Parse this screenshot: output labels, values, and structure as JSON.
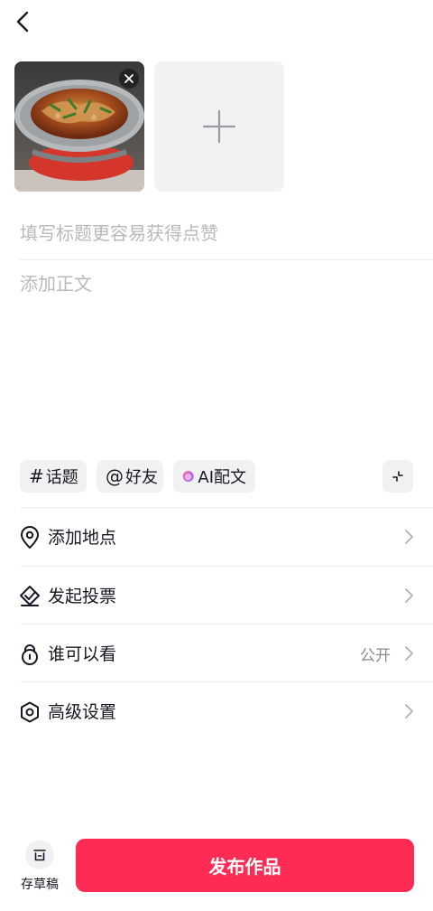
{
  "header": {
    "back_icon": "chevron-left-icon"
  },
  "media": {
    "photo_alt": "",
    "remove_icon": "close-icon",
    "add_icon": "plus-icon"
  },
  "post": {
    "title_placeholder": "填写标题更容易获得点赞",
    "body_placeholder": "添加正文"
  },
  "chips": {
    "topic_symbol": "#",
    "topic_label": "话题",
    "friend_symbol": "@",
    "friend_label": "好友",
    "ai_label": "AI配文",
    "collapse_icon": "collapse-icon"
  },
  "options": [
    {
      "label": "添加地点",
      "value": "",
      "icon": "location-pin-icon"
    },
    {
      "label": "发起投票",
      "value": "",
      "icon": "vote-icon"
    },
    {
      "label": "谁可以看",
      "value": "公开",
      "icon": "lock-icon"
    },
    {
      "label": "高级设置",
      "value": "",
      "icon": "settings-icon"
    }
  ],
  "footer": {
    "draft_label": "存草稿",
    "publish_label": "发布作品"
  },
  "colors": {
    "accent": "#fe2c55",
    "chip_bg": "#f1f1f2",
    "placeholder": "#b8b9bd"
  }
}
